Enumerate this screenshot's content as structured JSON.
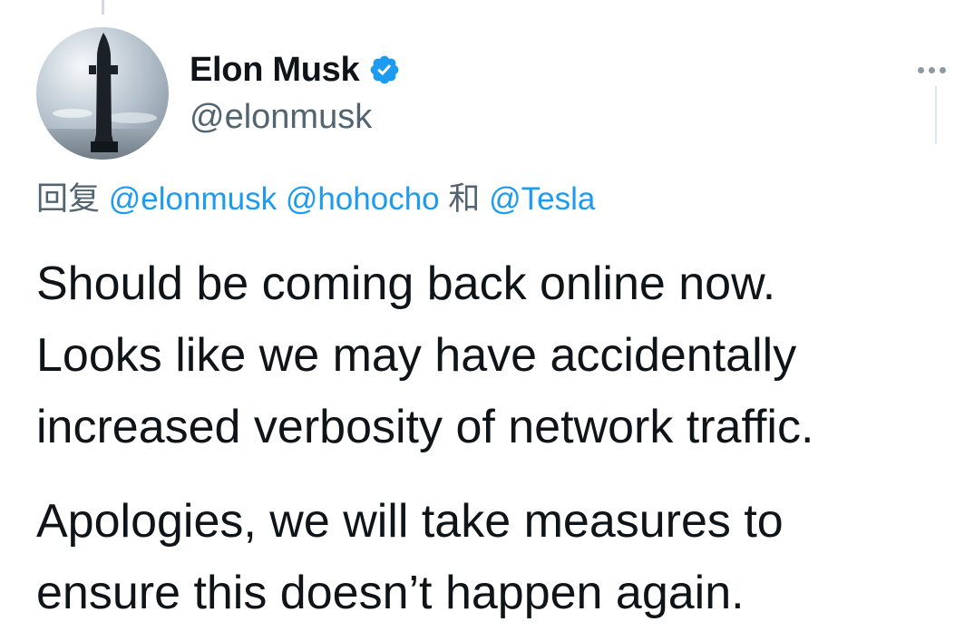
{
  "author": {
    "display_name": "Elon Musk",
    "handle": "@elonmusk",
    "verified": true
  },
  "reply": {
    "prefix": "回复",
    "mentions": [
      "@elonmusk",
      "@hohocho"
    ],
    "conjunction": "和",
    "last_mention": "@Tesla"
  },
  "tweet": {
    "paragraphs": [
      "Should be coming back online now.\nLooks like we may have accidentally\nincreased verbosity of network traffic.",
      "Apologies, we will take measures to\nensure this doesn’t happen again."
    ]
  },
  "icons": {
    "verified": "verified-badge-icon",
    "more": "more-options-icon"
  },
  "colors": {
    "accent": "#1d9bf0",
    "text": "#0f1419",
    "secondary": "#536471"
  }
}
